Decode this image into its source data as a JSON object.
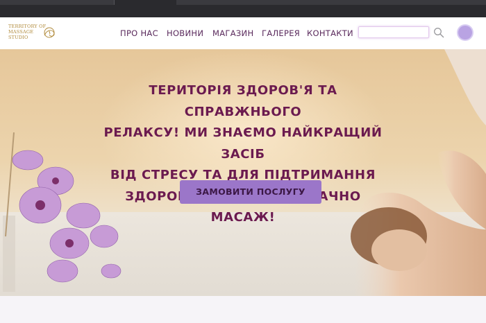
{
  "brand": {
    "line1": "TERRITORY OF",
    "line2": "MASSAGE",
    "line3": "STUDIO"
  },
  "nav": {
    "items": [
      {
        "label": "ПРО НАС"
      },
      {
        "label": "НОВИНИ"
      },
      {
        "label": "МАГАЗИН"
      },
      {
        "label": "ГАЛЕРЕЯ"
      },
      {
        "label": "КОНТАКТИ"
      }
    ]
  },
  "search": {
    "value": "",
    "placeholder": ""
  },
  "hero": {
    "headline_lines": [
      "ТЕРИТОРІЯ ЗДОРОВ'Я ТА СПРАВЖНЬОГО",
      "РЕЛАКСУ! МИ ЗНАЄМО НАЙКРАЩИЙ ЗАСІБ",
      "ВІД СТРЕСУ ТА ДЛЯ ПІДТРИМАННЯ",
      "ЗДОРОВ'Я – І ЦЕ ОДНОЗНАЧНО МАСАЖ!"
    ],
    "cta_label": "ЗАМОВИТИ ПОСЛУГУ"
  },
  "icons": {
    "search": "search-icon",
    "avatar": "avatar",
    "logo_swirl": "logo-swirl-icon"
  },
  "colors": {
    "accent": "#9b76c9",
    "headline": "#6b1a4f",
    "nav": "#5a2a5c",
    "logo": "#b08a3a"
  }
}
